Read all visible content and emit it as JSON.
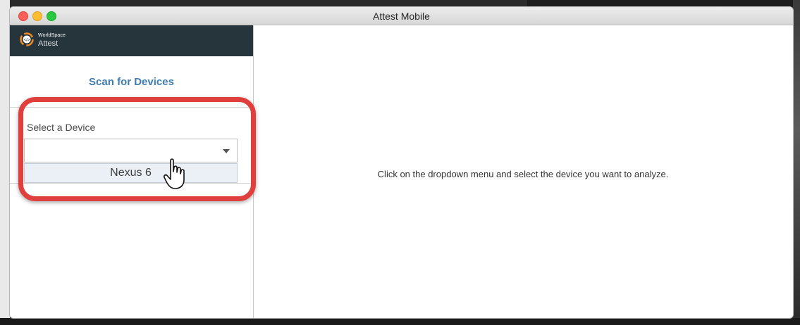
{
  "window": {
    "title": "Attest Mobile"
  },
  "brand": {
    "line1": "WorldSpace",
    "line2": "Attest"
  },
  "sidebar": {
    "scan_button": "Scan for Devices",
    "select_label": "Select a Device",
    "select_value": "",
    "options": [
      "Nexus 6"
    ]
  },
  "main": {
    "message": "Click on the dropdown menu and select the device you want to analyze."
  },
  "colors": {
    "accent": "#3e7cb1",
    "header": "#26343c",
    "highlight": "#e0403d"
  },
  "icons": {
    "logo": "worldspace-logo-icon",
    "caret": "chevron-down-icon",
    "cursor": "hand-pointer-icon"
  }
}
